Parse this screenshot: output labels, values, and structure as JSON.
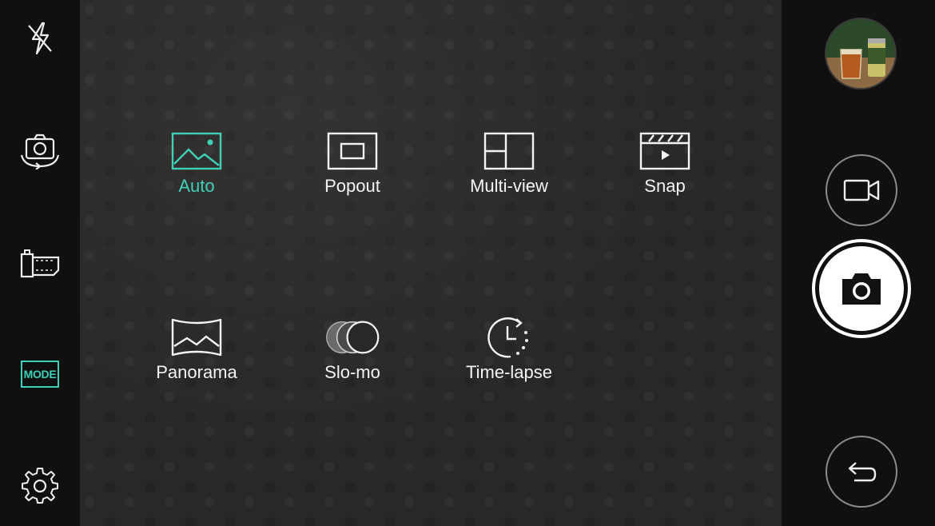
{
  "left_toolbar": {
    "flash_icon": "flash-off-icon",
    "switch_camera_icon": "switch-camera-icon",
    "film_icon": "film-effect-icon",
    "mode_label": "MODE",
    "settings_icon": "gear-icon"
  },
  "modes": [
    {
      "label": "Auto",
      "icon": "auto-photo-icon",
      "selected": true
    },
    {
      "label": "Popout",
      "icon": "popout-icon",
      "selected": false
    },
    {
      "label": "Multi-view",
      "icon": "multi-view-icon",
      "selected": false
    },
    {
      "label": "Snap",
      "icon": "snap-clapper-icon",
      "selected": false
    },
    {
      "label": "Panorama",
      "icon": "panorama-icon",
      "selected": false
    },
    {
      "label": "Slo-mo",
      "icon": "slo-mo-icon",
      "selected": false
    },
    {
      "label": "Time-lapse",
      "icon": "time-lapse-icon",
      "selected": false
    }
  ],
  "right_controls": {
    "gallery_thumbnail": "gallery-thumbnail",
    "video_icon": "video-camera-icon",
    "shutter_icon": "camera-icon",
    "back_icon": "back-arrow-icon"
  },
  "colors": {
    "accent": "#3fd0b8",
    "text": "#f4f4f4",
    "panel": "#101010"
  }
}
